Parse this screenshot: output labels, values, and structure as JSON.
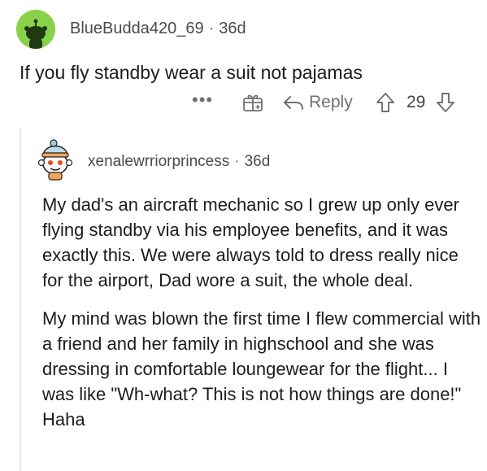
{
  "comment": {
    "author": "BlueBudda420_69",
    "age": "36d",
    "body": "If you fly standby wear a suit not pajamas",
    "actions": {
      "more": "•••",
      "reply_label": "Reply",
      "score": "29"
    }
  },
  "reply": {
    "author": "xenalewrriorprincess",
    "age": "36d",
    "paragraphs": [
      "My dad's an aircraft mechanic so I grew up only ever flying standby via his employee benefits, and it was exactly this. We were always told to dress really nice for the airport, Dad wore a suit, the whole deal.",
      "My mind was blown the first time I flew commercial with a friend and her family in highschool and she was dressing in comfortable loungewear for the flight... I was like \"Wh-what? This is not how things are done!\" Haha"
    ]
  },
  "icons": {
    "avatar1": "snoo-avatar-green",
    "avatar2": "snoo-avatar-hat",
    "award": "gift-award-icon",
    "reply": "reply-arrow-icon",
    "upvote": "upvote-arrow-icon",
    "downvote": "downvote-arrow-icon"
  },
  "colors": {
    "avatar1_bg": "#8ad14a",
    "text": "#1c1c1c",
    "meta": "#4a4a4a",
    "icon": "#6f6f6f",
    "thread_line": "#e4e4e4"
  }
}
